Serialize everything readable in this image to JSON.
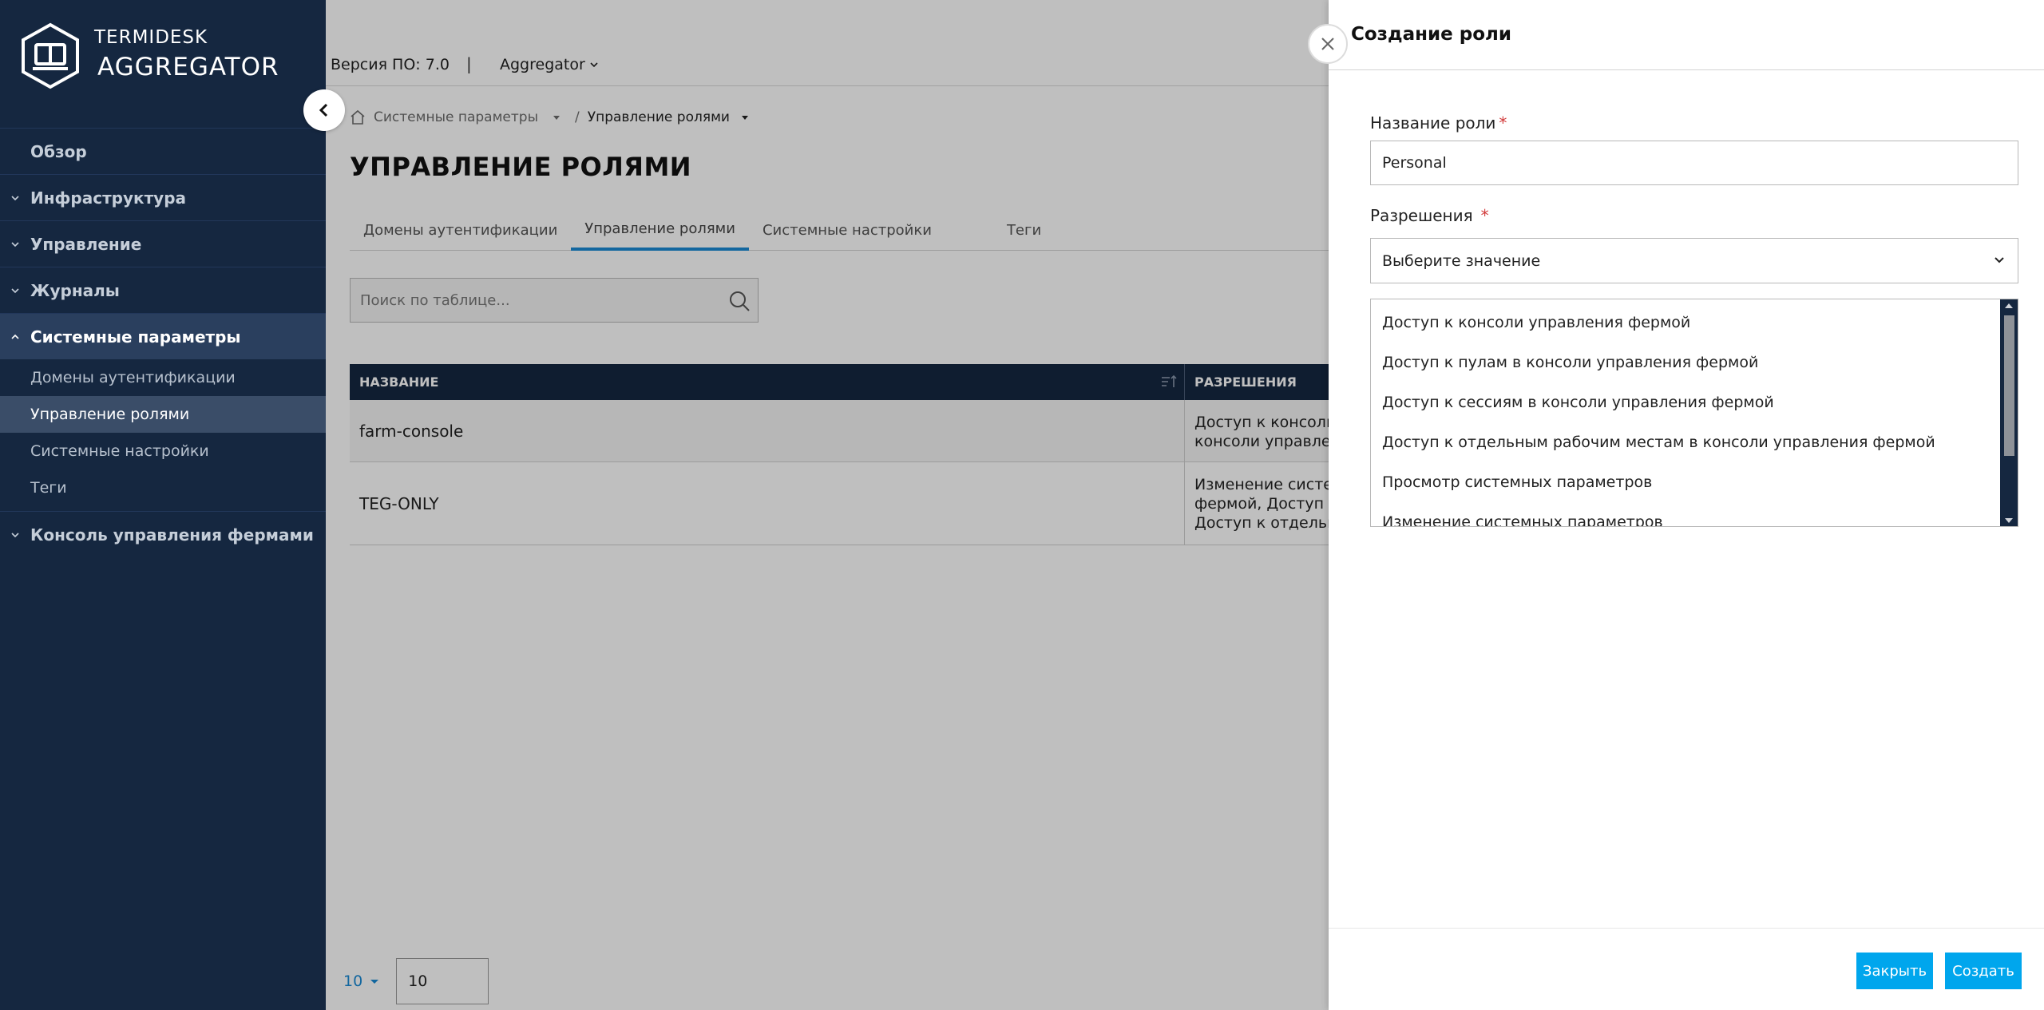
{
  "colors": {
    "sidebar_bg": "#152740",
    "accent": "#1a8ad4",
    "button": "#00a6ed",
    "required": "#d23a3a"
  },
  "logo": {
    "line1": "TERMIDESK",
    "line2": "AGGREGATOR",
    "icon": "monitor-hexagon-icon"
  },
  "sidebar": {
    "items": [
      {
        "label": "Обзор"
      },
      {
        "label": "Инфраструктура"
      },
      {
        "label": "Управление"
      },
      {
        "label": "Журналы"
      },
      {
        "label": "Системные параметры"
      },
      {
        "label": "Консоль управления фермами"
      }
    ],
    "subitems": [
      {
        "label": "Домены аутентификации"
      },
      {
        "label": "Управление ролями"
      },
      {
        "label": "Системные настройки"
      },
      {
        "label": "Теги"
      }
    ]
  },
  "topbar": {
    "version": "Версия ПО: 7.0",
    "separator": "|",
    "aggregator": "Aggregator"
  },
  "breadcrumb": {
    "parent": "Системные параметры",
    "slash": "/",
    "current": "Управление ролями"
  },
  "page": {
    "title": "УПРАВЛЕНИЕ РОЛЯМИ"
  },
  "tabs": [
    {
      "label": "Домены аутентификации"
    },
    {
      "label": "Управление ролями"
    },
    {
      "label": "Системные настройки"
    },
    {
      "label": "Теги"
    }
  ],
  "search": {
    "placeholder": "Поиск по таблице..."
  },
  "table": {
    "headers": [
      "НАЗВАНИЕ",
      "РАЗРЕШЕНИЯ"
    ],
    "rows": [
      {
        "name": "farm-console",
        "perm_line1": "Доступ к консоли",
        "perm_line2": "консоли управлен"
      },
      {
        "name": "TEG-ONLY",
        "perm_line1": "Изменение систем",
        "perm_line2": "фермой, Доступ к",
        "perm_line3": "Доступ к отдельны"
      }
    ]
  },
  "pager": {
    "page_size": "10",
    "page": "10"
  },
  "panel": {
    "title": "Создание роли",
    "role_label": "Название роли",
    "required_mark": "*",
    "role_value": "Personal",
    "perm_label": "Разрешения",
    "perm_placeholder": "Выберите значение",
    "options": [
      "Доступ к консоли управления фермой",
      "Доступ к пулам в консоли управления фермой",
      "Доступ к сессиям в консоли управления фермой",
      "Доступ к отдельным рабочим местам в консоли управления фермой",
      "Просмотр системных параметров",
      "Изменение системных параметров"
    ],
    "close_button": "Закрыть",
    "create_button": "Создать"
  }
}
